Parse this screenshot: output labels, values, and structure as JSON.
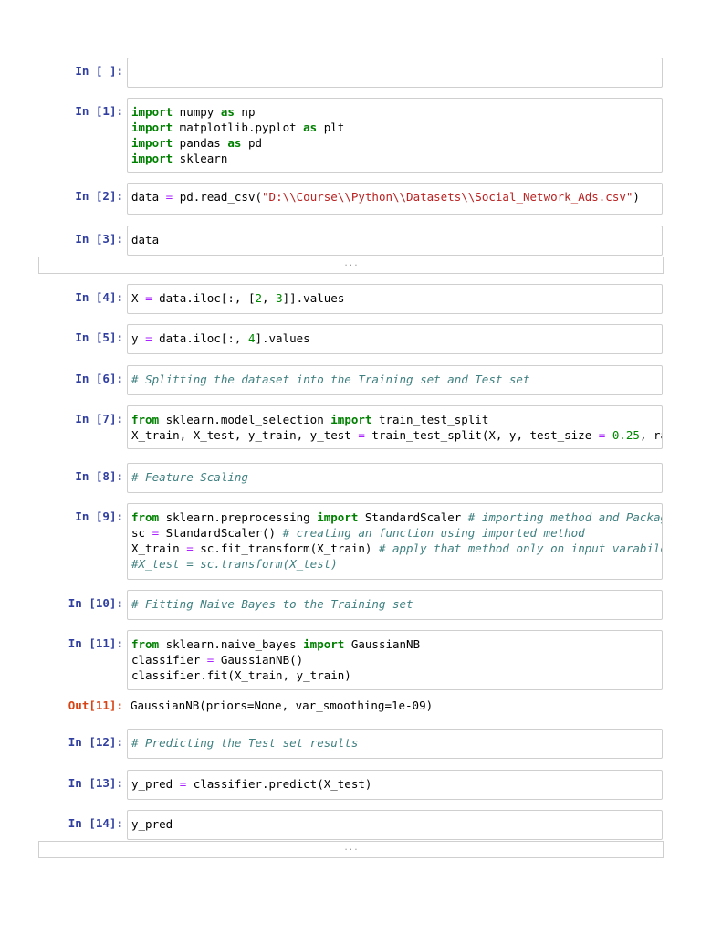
{
  "colors": {
    "prompt": "#303F9F",
    "out_prompt": "#D84315",
    "keyword": "#008000",
    "string": "#BA2121",
    "comment": "#408080"
  },
  "ellipsis": "...",
  "cells": [
    {
      "prompt": "In [ ]:",
      "lines": []
    },
    {
      "prompt": "In [1]:",
      "lines": [
        [
          [
            "kw",
            "import"
          ],
          [
            "t",
            " numpy "
          ],
          [
            "kw",
            "as"
          ],
          [
            "t",
            " np"
          ]
        ],
        [
          [
            "kw",
            "import"
          ],
          [
            "t",
            " matplotlib.pyplot "
          ],
          [
            "kw",
            "as"
          ],
          [
            "t",
            " plt"
          ]
        ],
        [
          [
            "kw",
            "import"
          ],
          [
            "t",
            " pandas "
          ],
          [
            "kw",
            "as"
          ],
          [
            "t",
            " pd"
          ]
        ],
        [
          [
            "kw",
            "import"
          ],
          [
            "t",
            " sklearn"
          ]
        ]
      ]
    },
    {
      "prompt": "In [2]:",
      "lines": [
        [
          [
            "t",
            "data "
          ],
          [
            "op",
            "="
          ],
          [
            "t",
            " pd.read_csv("
          ],
          [
            "str",
            "\"D:\\\\Course\\\\Python\\\\Datasets\\\\Social_Network_Ads.csv\""
          ],
          [
            "t",
            ")"
          ]
        ]
      ]
    },
    {
      "prompt": "In [3]:",
      "lines": [
        [
          [
            "t",
            "data"
          ]
        ]
      ]
    },
    {
      "prompt": "In [4]:",
      "lines": [
        [
          [
            "t",
            "X "
          ],
          [
            "op",
            "="
          ],
          [
            "t",
            " data.iloc[:, ["
          ],
          [
            "num",
            "2"
          ],
          [
            "t",
            ", "
          ],
          [
            "num",
            "3"
          ],
          [
            "t",
            "]].values"
          ]
        ]
      ]
    },
    {
      "prompt": "In [5]:",
      "lines": [
        [
          [
            "t",
            "y "
          ],
          [
            "op",
            "="
          ],
          [
            "t",
            " data.iloc[:, "
          ],
          [
            "num",
            "4"
          ],
          [
            "t",
            "].values"
          ]
        ]
      ]
    },
    {
      "prompt": "In [6]:",
      "lines": [
        [
          [
            "cm",
            "# Splitting the dataset into the Training set and Test set"
          ]
        ]
      ]
    },
    {
      "prompt": "In [7]:",
      "lines": [
        [
          [
            "kw",
            "from"
          ],
          [
            "t",
            " sklearn.model_selection "
          ],
          [
            "kw",
            "import"
          ],
          [
            "t",
            " train_test_split"
          ]
        ],
        [
          [
            "t",
            "X_train, X_test, y_train, y_test "
          ],
          [
            "op",
            "="
          ],
          [
            "t",
            " train_test_split(X, y, test_size "
          ],
          [
            "op",
            "="
          ],
          [
            "t",
            " "
          ],
          [
            "num",
            "0.25"
          ],
          [
            "t",
            ", rando"
          ]
        ]
      ]
    },
    {
      "prompt": "In [8]:",
      "lines": [
        [
          [
            "cm",
            "# Feature Scaling"
          ]
        ]
      ]
    },
    {
      "prompt": "In [9]:",
      "lines": [
        [
          [
            "kw",
            "from"
          ],
          [
            "t",
            " sklearn.preprocessing "
          ],
          [
            "kw",
            "import"
          ],
          [
            "t",
            " StandardScaler "
          ],
          [
            "cm",
            "# importing method and Packages"
          ]
        ],
        [
          [
            "t",
            "sc "
          ],
          [
            "op",
            "="
          ],
          [
            "t",
            " StandardScaler() "
          ],
          [
            "cm",
            "# creating an function using imported method"
          ]
        ],
        [
          [
            "t",
            "X_train "
          ],
          [
            "op",
            "="
          ],
          [
            "t",
            " sc.fit_transform(X_train) "
          ],
          [
            "cm",
            "# apply that method only on input varabile"
          ]
        ],
        [
          [
            "cm",
            "#X_test = sc.transform(X_test)"
          ]
        ]
      ]
    },
    {
      "prompt": "In [10]:",
      "lines": [
        [
          [
            "cm",
            "# Fitting Naive Bayes to the Training set"
          ]
        ]
      ]
    },
    {
      "prompt": "In [11]:",
      "lines": [
        [
          [
            "kw",
            "from"
          ],
          [
            "t",
            " sklearn.naive_bayes "
          ],
          [
            "kw",
            "import"
          ],
          [
            "t",
            " GaussianNB"
          ]
        ],
        [
          [
            "t",
            "classifier "
          ],
          [
            "op",
            "="
          ],
          [
            "t",
            " GaussianNB()"
          ]
        ],
        [
          [
            "t",
            "classifier.fit(X_train, y_train)"
          ]
        ]
      ],
      "out_prompt": "Out[11]:",
      "output": "GaussianNB(priors=None, var_smoothing=1e-09)"
    },
    {
      "prompt": "In [12]:",
      "lines": [
        [
          [
            "cm",
            "# Predicting the Test set results"
          ]
        ]
      ]
    },
    {
      "prompt": "In [13]:",
      "lines": [
        [
          [
            "t",
            "y_pred "
          ],
          [
            "op",
            "="
          ],
          [
            "t",
            " classifier.predict(X_test)"
          ]
        ]
      ]
    },
    {
      "prompt": "In [14]:",
      "lines": [
        [
          [
            "t",
            "y_pred"
          ]
        ]
      ]
    }
  ]
}
